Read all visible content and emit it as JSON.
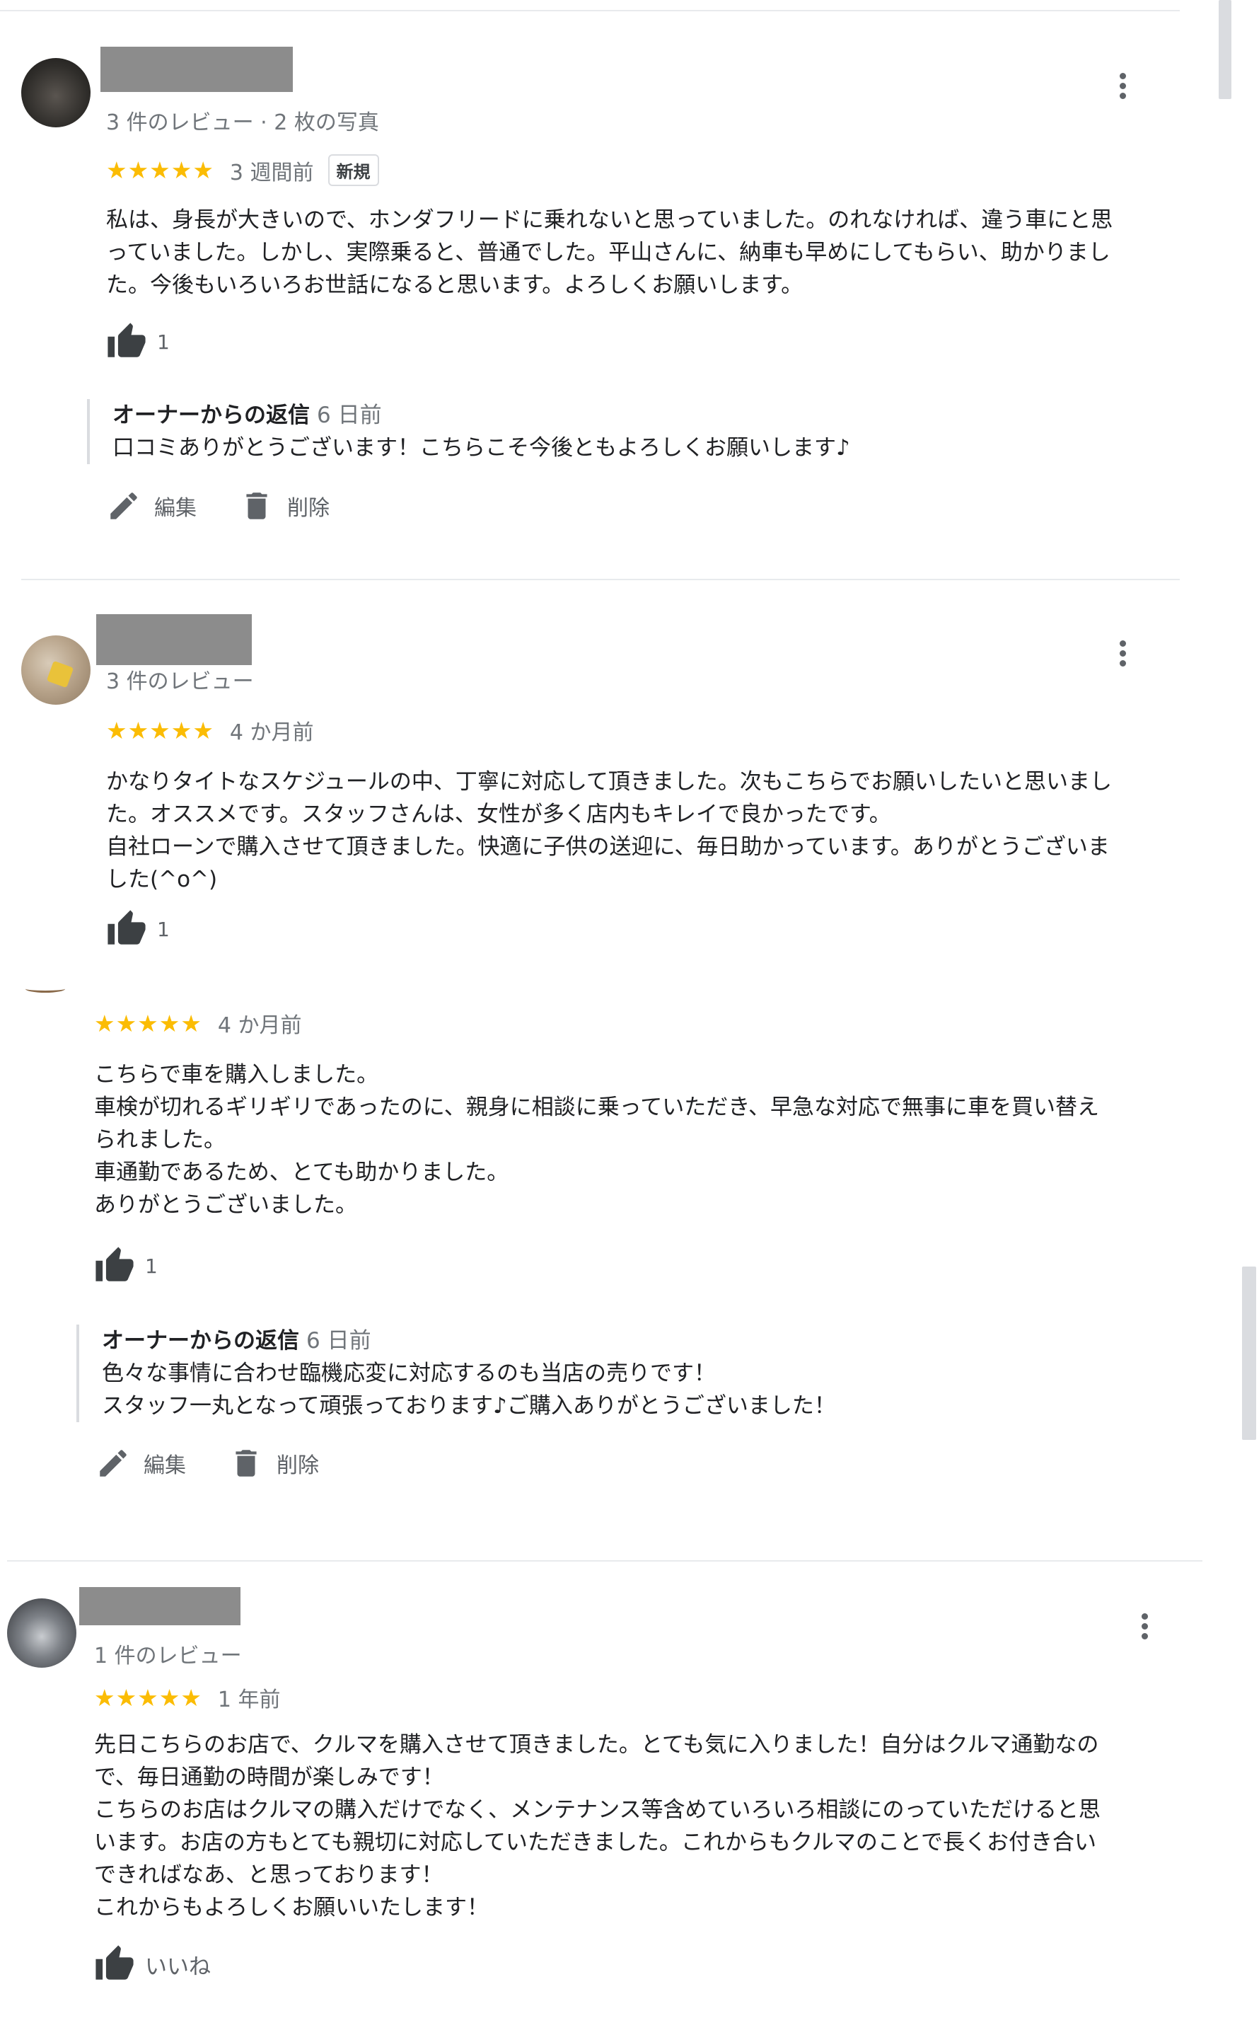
{
  "reviews": [
    {
      "meta": "3 件のレビュー · 2 枚の写真",
      "stars": "★★★★★",
      "time": "3 週間前",
      "badge": "新規",
      "text": "私は、身長が大きいので、ホンダフリードに乗れないと思っていました。のれなければ、違う車にと思\nっていました。しかし、実際乗ると、普通でした。平山さんに、納車も早めにしてもらい、助かりまし\nた。今後もいろいろお世話になると思います。よろしくお願いします。",
      "likes": "1",
      "reply": {
        "owner": "オーナーからの返信",
        "time": "6 日前",
        "text": "口コミありがとうございます！こちらこそ今後ともよろしくお願いします♪"
      },
      "actions": {
        "edit": "編集",
        "delete": "削除"
      }
    },
    {
      "meta": "3 件のレビュー",
      "stars": "★★★★★",
      "time": "4 か月前",
      "text": "かなりタイトなスケジュールの中、丁寧に対応して頂きました。次もこちらでお願いしたいと思いまし\nた。オススメです。スタッフさんは、女性が多く店内もキレイで良かったです。\n自社ローンで購入させて頂きました。快適に子供の送迎に、毎日助かっています。ありがとうございま\nした(^o^)",
      "likes": "1"
    },
    {
      "stars": "★★★★★",
      "time": "4 か月前",
      "text": "こちらで車を購入しました。\n車検が切れるギリギリであったのに、親身に相談に乗っていただき、早急な対応で無事に車を買い替え\nられました。\n車通勤であるため、とても助かりました。\nありがとうございました。",
      "likes": "1",
      "reply": {
        "owner": "オーナーからの返信",
        "time": "6 日前",
        "text": "色々な事情に合わせ臨機応変に対応するのも当店の売りです！\nスタッフ一丸となって頑張っております♪ご購入ありがとうございました！"
      },
      "actions": {
        "edit": "編集",
        "delete": "削除"
      }
    },
    {
      "meta": "1 件のレビュー",
      "stars": "★★★★★",
      "time": "1 年前",
      "text": "先日こちらのお店で、クルマを購入させて頂きました。とても気に入りました！自分はクルマ通勤なの\nで、毎日通勤の時間が楽しみです！\nこちらのお店はクルマの購入だけでなく、メンテナンス等含めていろいろ相談にのっていただけると思\nいます。お店の方もとても親切に対応していただきました。これからもクルマのことで長くお付き合い\nできればなあ、と思っております！\nこれからもよろしくお願いいたします！",
      "like_label": "いいね"
    }
  ],
  "colors": {
    "star": "#fbbc04",
    "secondary_text": "#70757a",
    "divider": "#e8eaed"
  },
  "icons": [
    "thumbs-up-icon",
    "pencil-icon",
    "trash-icon",
    "more-vert-icon"
  ]
}
